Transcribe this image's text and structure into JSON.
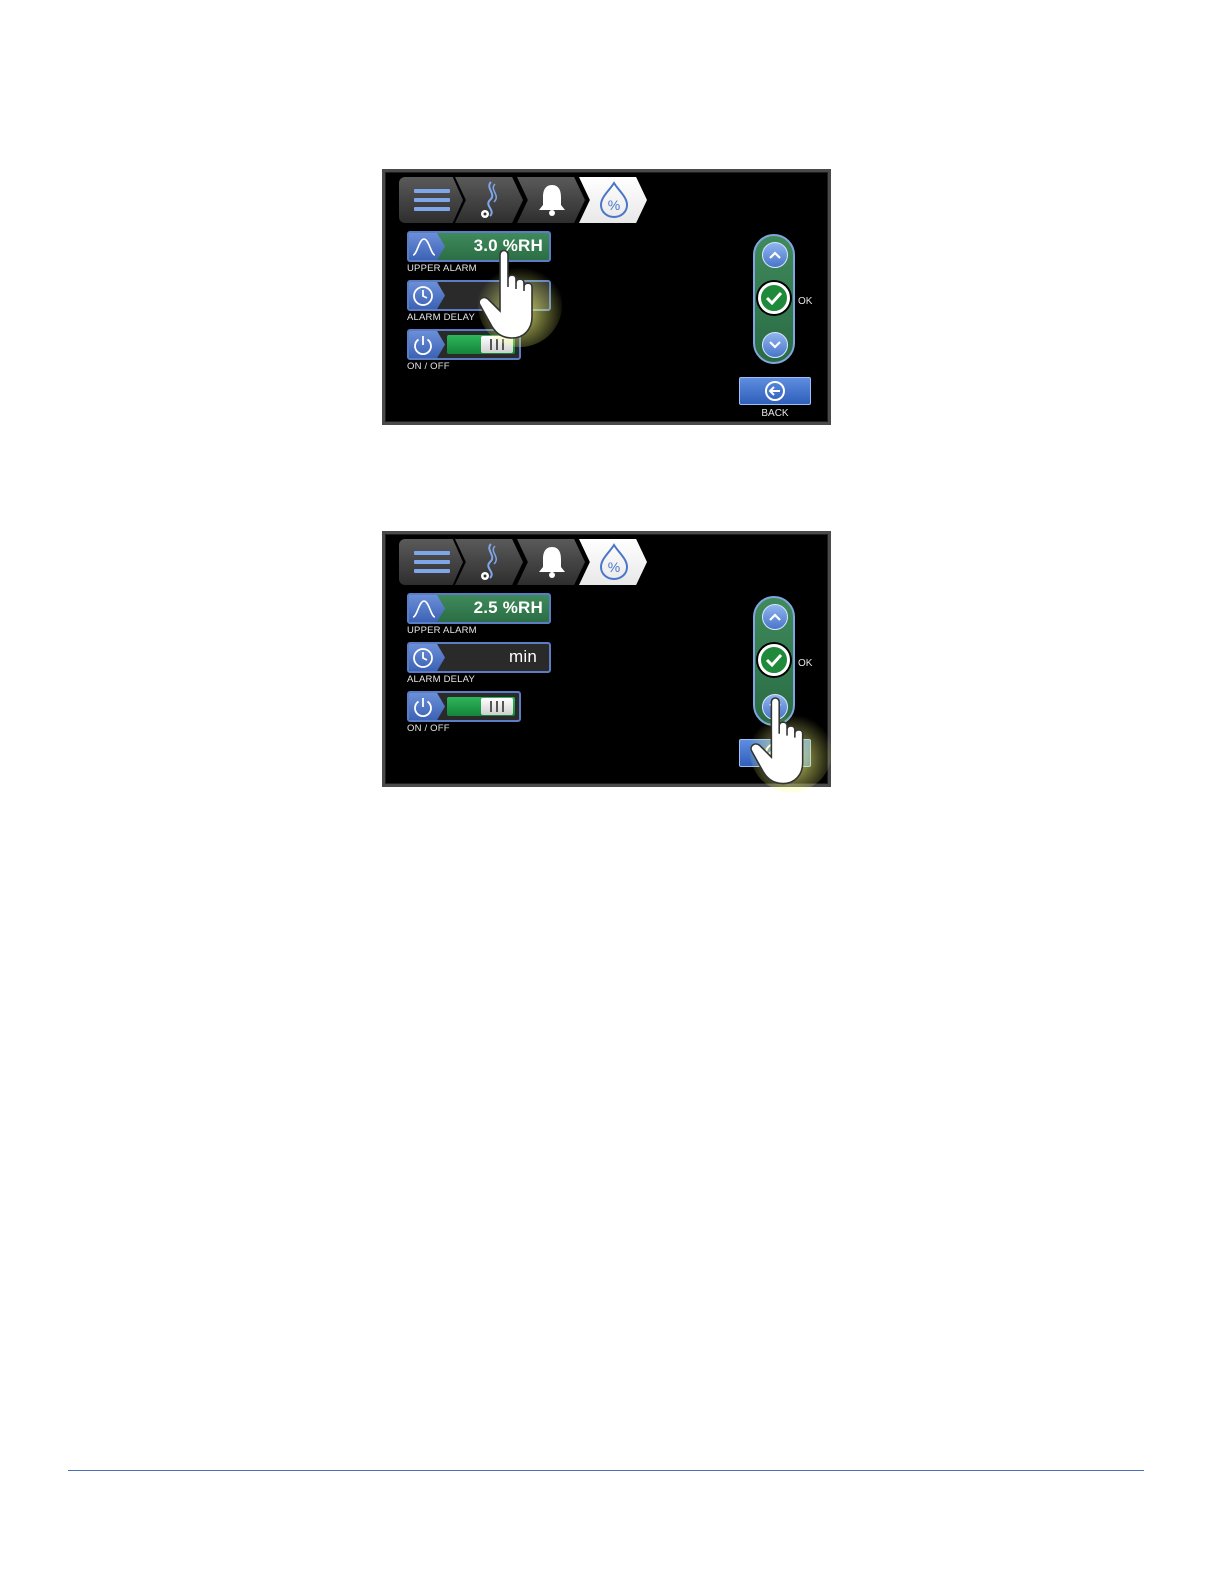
{
  "screens": [
    {
      "nav": {
        "items": [
          "menu-icon",
          "steam-settings-icon",
          "bell-icon",
          "humidity-percent-icon"
        ],
        "active": 3
      },
      "upper_alarm": {
        "value": "3.0 %RH",
        "label": "UPPER ALARM"
      },
      "alarm_delay": {
        "value": "",
        "label": "ALARM DELAY"
      },
      "on_off": {
        "label": "ON / OFF",
        "state": "on"
      },
      "controls": {
        "ok_label": "OK",
        "back_label": "BACK"
      },
      "pointer": "touching-upper-alarm"
    },
    {
      "nav": {
        "items": [
          "menu-icon",
          "steam-settings-icon",
          "bell-icon",
          "humidity-percent-icon"
        ],
        "active": 3
      },
      "upper_alarm": {
        "value": "2.5 %RH",
        "label": "UPPER ALARM"
      },
      "alarm_delay": {
        "value": "min",
        "label": "ALARM DELAY"
      },
      "on_off": {
        "label": "ON / OFF",
        "state": "on"
      },
      "controls": {
        "ok_label": "OK",
        "back_label": ""
      },
      "pointer": "touching-down-button"
    }
  ],
  "colors": {
    "active_field": "#3f8a5c",
    "accent_blue": "#5a7dc4",
    "toggle_on": "#2fb55a",
    "footer_rule": "#4a6fb5"
  }
}
